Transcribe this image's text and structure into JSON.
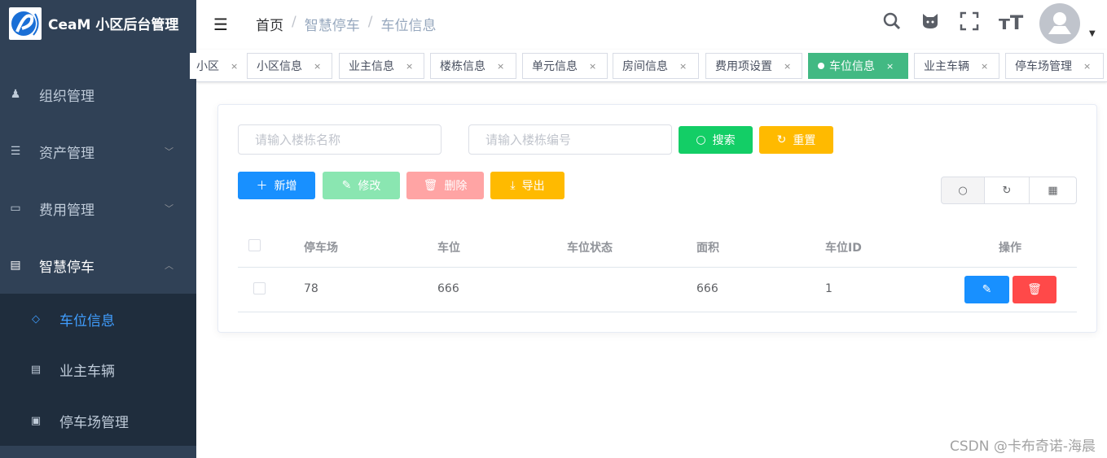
{
  "app": {
    "title": "CeaM 小区后台管理"
  },
  "sidebar": {
    "items": [
      {
        "label": "组织管理"
      },
      {
        "label": "资产管理"
      },
      {
        "label": "费用管理"
      },
      {
        "label": "智慧停车"
      }
    ],
    "sub_items": [
      {
        "label": "车位信息"
      },
      {
        "label": "业主车辆"
      },
      {
        "label": "停车场管理"
      }
    ]
  },
  "breadcrumb": [
    "首页",
    "/",
    "智慧停车",
    "/",
    "车位信息"
  ],
  "tags": [
    {
      "label": "小区"
    },
    {
      "label": "小区信息"
    },
    {
      "label": "业主信息"
    },
    {
      "label": "楼栋信息"
    },
    {
      "label": "单元信息"
    },
    {
      "label": "房间信息"
    },
    {
      "label": "费用项设置"
    },
    {
      "label": "车位信息"
    },
    {
      "label": "业主车辆"
    },
    {
      "label": "停车场管理"
    }
  ],
  "tag_close": "×",
  "search": {
    "name_placeholder": "请输入楼栋名称",
    "code_placeholder": "请输入楼栋编号",
    "search_label": "搜索",
    "reset_label": "重置"
  },
  "toolbar": {
    "add": "新增",
    "edit": "修改",
    "delete": "删除",
    "export": "导出"
  },
  "table": {
    "headers": [
      "停车场",
      "车位",
      "车位状态",
      "面积",
      "车位ID",
      "操作"
    ],
    "rows": [
      {
        "lot": "78",
        "space": "666",
        "status": "",
        "area": "666",
        "id": "1"
      }
    ]
  },
  "watermark": "CSDN @卡布奇诺-海晨",
  "colors": {
    "sidebar": "#304156",
    "submenu": "#1f2d3d",
    "active": "#409eff",
    "tag_active": "#42b983",
    "primary": "#1890ff",
    "success": "#13ce66",
    "warning": "#ffba00",
    "danger": "#ff4949"
  }
}
